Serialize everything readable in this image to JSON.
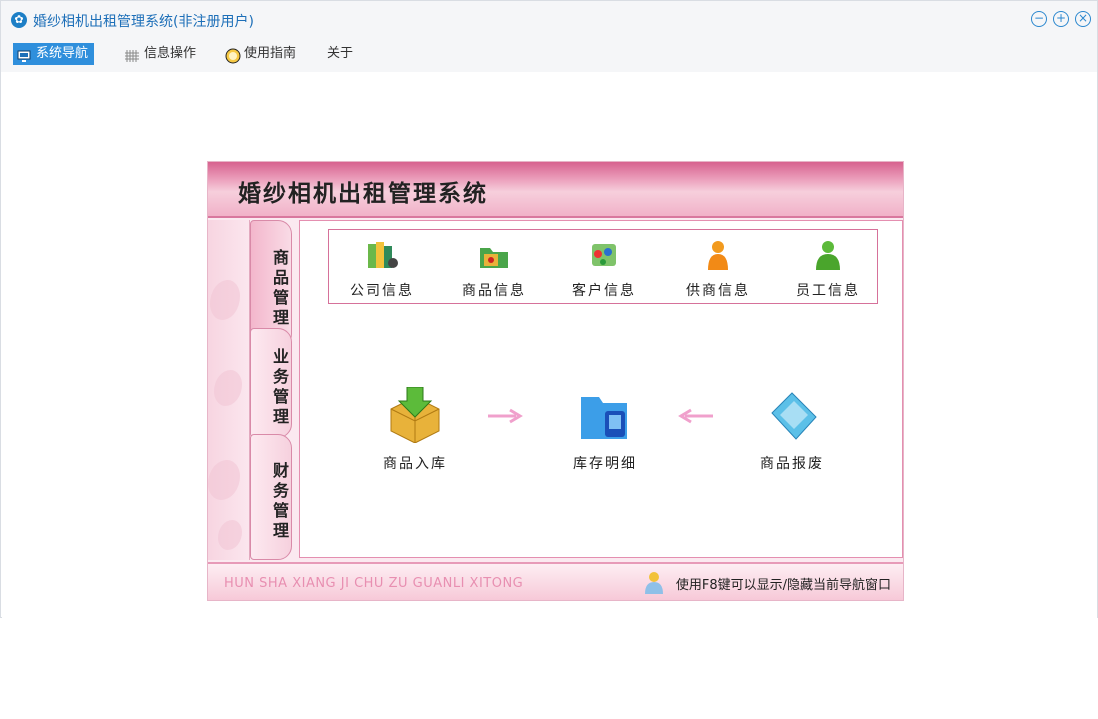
{
  "window": {
    "title": "婚纱相机出租管理系统(非注册用户)",
    "controls": [
      "minimize-icon",
      "maximize-icon",
      "close-icon"
    ]
  },
  "menu": {
    "items": [
      {
        "label": "系统导航",
        "icon": "monitor-icon",
        "active": true
      },
      {
        "label": "信息操作",
        "icon": "grid-icon",
        "active": false
      },
      {
        "label": "使用指南",
        "icon": "clock-icon",
        "active": false
      },
      {
        "label": "关于",
        "icon": "",
        "active": false
      }
    ]
  },
  "nav": {
    "title": "婚纱相机出租管理系统",
    "tabs": [
      {
        "label": "商品管理",
        "active": true
      },
      {
        "label": "业务管理",
        "active": false
      },
      {
        "label": "财务管理",
        "active": false
      }
    ],
    "top_items": [
      {
        "label": "公司信息",
        "icon": "books-icon"
      },
      {
        "label": "商品信息",
        "icon": "folder-box-icon"
      },
      {
        "label": "客户信息",
        "icon": "contacts-icon"
      },
      {
        "label": "供商信息",
        "icon": "person-orange-icon"
      },
      {
        "label": "员工信息",
        "icon": "person-green-icon"
      }
    ],
    "flow": [
      {
        "label": "商品入库",
        "icon": "box-download-icon"
      },
      {
        "label": "库存明细",
        "icon": "folder-doc-icon"
      },
      {
        "label": "商品报废",
        "icon": "discard-icon"
      }
    ],
    "footer_text": "HUN SHA XIANG JI CHU ZU GUANLI XITONG",
    "footer_hint": "使用F8键可以显示/隐藏当前导航窗口"
  },
  "colors": {
    "accent": "#2f8fdc",
    "header_pink": "#e07aa2",
    "border_pink": "#d6719a"
  }
}
